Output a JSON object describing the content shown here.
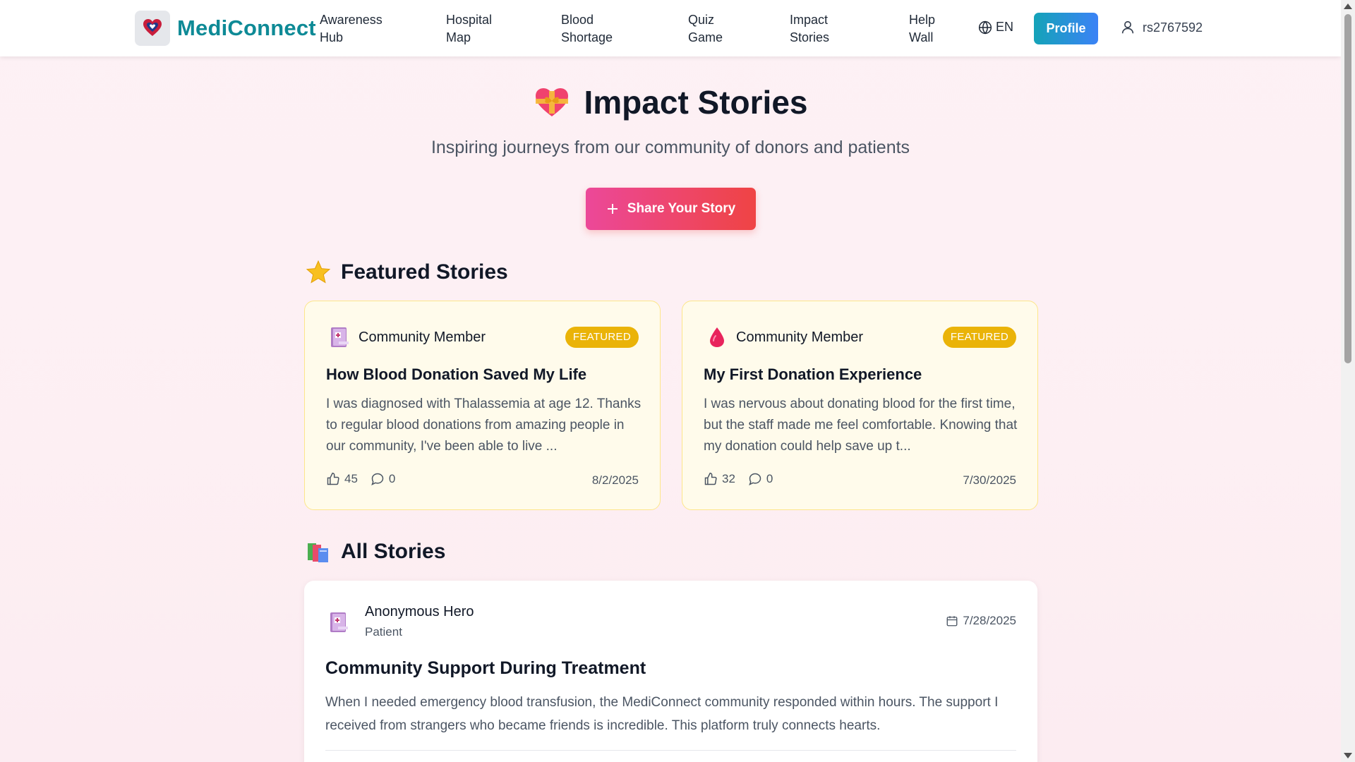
{
  "header": {
    "brand": "MediConnect",
    "nav": [
      {
        "line1": "Awareness",
        "line2": "Hub"
      },
      {
        "line1": "Hospital",
        "line2": "Map"
      },
      {
        "line1": "Blood",
        "line2": "Shortage"
      },
      {
        "line1": "Quiz",
        "line2": "Game"
      },
      {
        "line1": "Impact",
        "line2": "Stories"
      },
      {
        "line1": "Help",
        "line2": "Wall"
      }
    ],
    "language": "EN",
    "profile_label": "Profile",
    "username": "rs2767592"
  },
  "hero": {
    "title": "Impact Stories",
    "title_icon": "heart-with-ribbon-icon",
    "subtitle": "Inspiring journeys from our community of donors and patients",
    "share_button": "Share Your Story"
  },
  "featured": {
    "heading": "Featured Stories",
    "heading_icon": "star-icon",
    "badge_label": "FEATURED",
    "cards": [
      {
        "author": "Community Member",
        "author_icon": "book-icon",
        "title": "How Blood Donation Saved My Life",
        "excerpt": "I was diagnosed with Thalassemia at age 12. Thanks to regular blood donations from amazing people in our community, I've been able to live ...",
        "likes": "45",
        "comments": "0",
        "date": "8/2/2025"
      },
      {
        "author": "Community Member",
        "author_icon": "blood-drop-icon",
        "title": "My First Donation Experience",
        "excerpt": "I was nervous about donating blood for the first time, but the staff made me feel comfortable. Knowing that my donation could help save up t...",
        "likes": "32",
        "comments": "0",
        "date": "7/30/2025"
      }
    ]
  },
  "all_stories": {
    "heading": "All Stories",
    "heading_icon": "books-icon",
    "items": [
      {
        "author": "Anonymous Hero",
        "role": "Patient",
        "date": "7/28/2025",
        "title": "Community Support During Treatment",
        "body": "When I needed emergency blood transfusion, the MediConnect community responded within hours. The support I received from strangers who became friends is incredible. This platform truly connects hearts."
      }
    ]
  },
  "colors": {
    "brand": "#0e8a96",
    "profile_gradient": [
      "#14a3b8",
      "#3b82f6"
    ],
    "share_gradient": [
      "#ec4899",
      "#ef4444"
    ],
    "featured_badge": "#eab308",
    "featured_card_bg": "#fffbeb"
  }
}
